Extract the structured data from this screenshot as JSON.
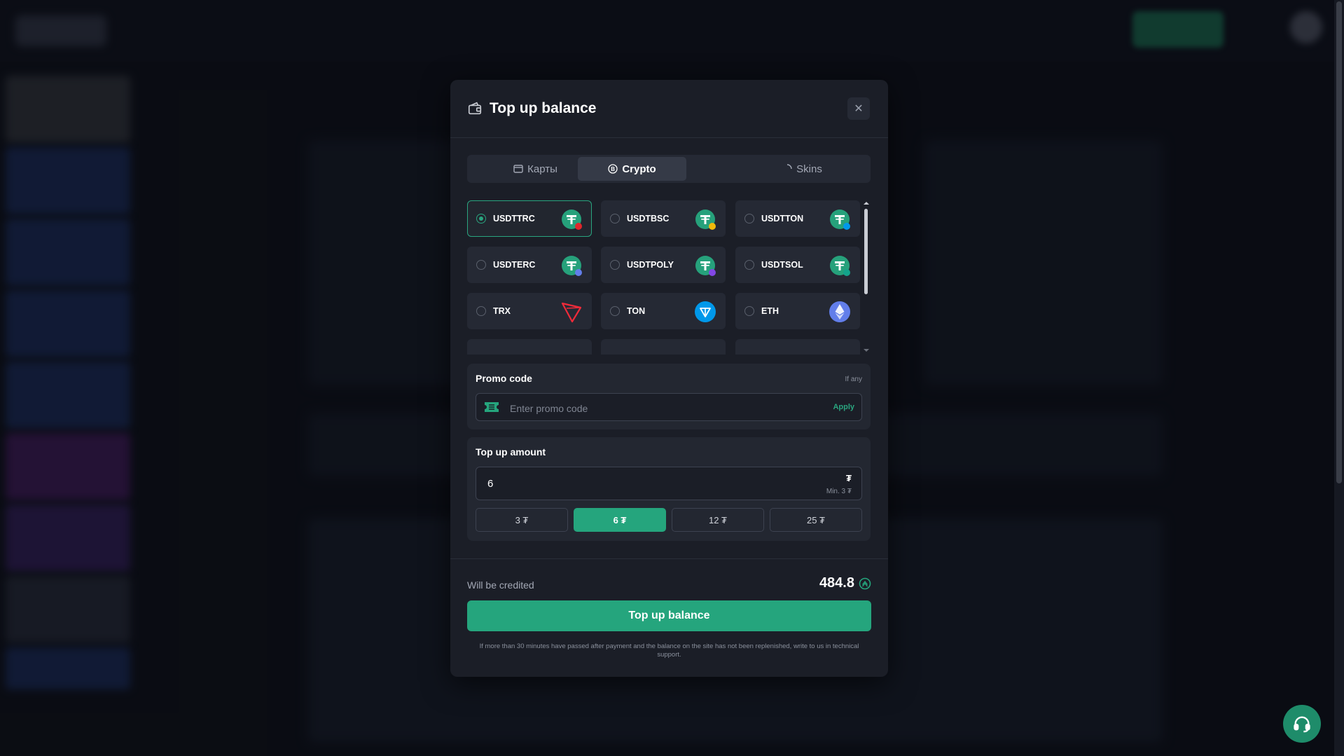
{
  "modal": {
    "title": "Top up balance",
    "close_symbol": "✕"
  },
  "tabs": [
    {
      "label": "Карты",
      "icon": "card-icon",
      "active": false
    },
    {
      "label": "Crypto",
      "icon": "bitcoin-icon",
      "active": true
    },
    {
      "label": "Skins",
      "icon": "spinner-icon",
      "active": false
    }
  ],
  "methods": [
    {
      "label": "USDTTRC",
      "icon": "tether-trc-icon",
      "selected": true
    },
    {
      "label": "USDTBSC",
      "icon": "tether-bsc-icon",
      "selected": false
    },
    {
      "label": "USDTTON",
      "icon": "tether-ton-icon",
      "selected": false
    },
    {
      "label": "USDTERC",
      "icon": "tether-erc-icon",
      "selected": false
    },
    {
      "label": "USDTPOLY",
      "icon": "tether-poly-icon",
      "selected": false
    },
    {
      "label": "USDTSOL",
      "icon": "tether-sol-icon",
      "selected": false
    },
    {
      "label": "TRX",
      "icon": "tron-icon",
      "selected": false
    },
    {
      "label": "TON",
      "icon": "ton-icon",
      "selected": false
    },
    {
      "label": "ETH",
      "icon": "ethereum-icon",
      "selected": false
    }
  ],
  "promo": {
    "label": "Promo code",
    "hint": "If any",
    "placeholder": "Enter promo code",
    "apply_label": "Apply"
  },
  "amount": {
    "label": "Top up amount",
    "value": "6",
    "currency": "₮",
    "min_label": "Min. 3 ₮",
    "presets": [
      {
        "label": "3 ₮",
        "active": false
      },
      {
        "label": "6 ₮",
        "active": true
      },
      {
        "label": "12 ₮",
        "active": false
      },
      {
        "label": "25 ₮",
        "active": false
      }
    ]
  },
  "credited": {
    "label": "Will be credited",
    "value": "484.8"
  },
  "submit_label": "Top up balance",
  "note": "If more than 30 minutes have passed after payment and the balance on the site has not been replenished, write to us in technical support.",
  "colors": {
    "accent": "#25a57d",
    "modal_bg": "#1b1e27",
    "card_bg": "#252934"
  }
}
